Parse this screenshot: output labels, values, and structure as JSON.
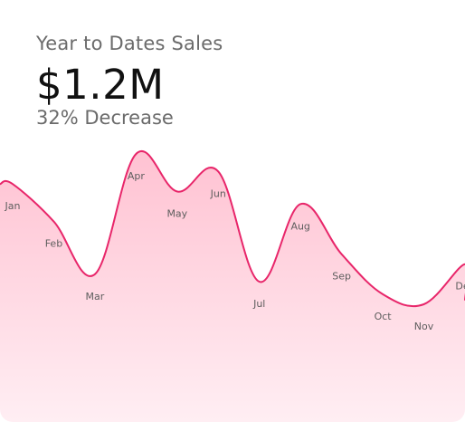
{
  "widget": {
    "title": "Year to Dates Sales",
    "total": "$1.2M",
    "change": "32% Decrease"
  },
  "chart_data": {
    "type": "area",
    "title": "",
    "xlabel": "",
    "ylabel": "",
    "categories": [
      "Jan",
      "Feb",
      "Mar",
      "Apr",
      "May",
      "Jun",
      "Jul",
      "Aug",
      "Sep",
      "Oct",
      "Nov",
      "Dec"
    ],
    "series": [
      {
        "values": [
          80,
          65,
          44,
          92,
          77,
          85,
          41,
          72,
          52,
          36,
          32,
          48
        ]
      }
    ],
    "ylim": [
      0,
      100
    ],
    "grid": false,
    "legend": "none",
    "colors": {
      "line": "#e8266a",
      "fill_top": "#ffc2d2",
      "fill_bottom": "#ffeef3"
    }
  }
}
